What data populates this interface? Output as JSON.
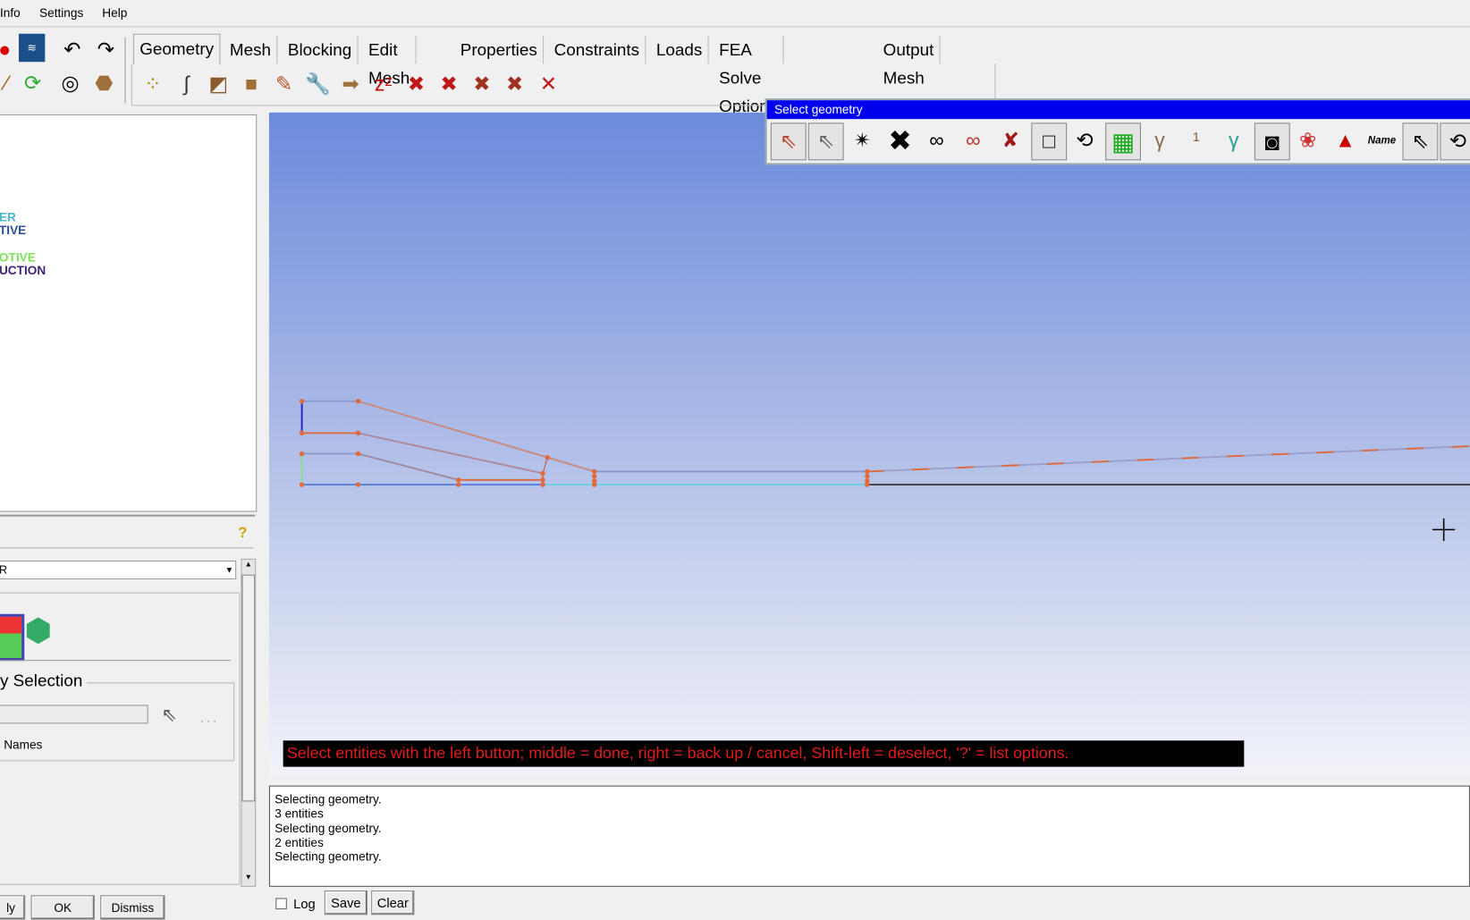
{
  "menu": {
    "items": [
      "Info",
      "Settings",
      "Help"
    ]
  },
  "tabs": [
    "Geometry",
    "Mesh",
    "Blocking",
    "Edit Mesh",
    "Properties",
    "Constraints",
    "Loads",
    "FEA Solve Options",
    "Output Mesh"
  ],
  "active_tab": "Geometry",
  "geometry_toolbar_icons": [
    "create-point-icon",
    "create-curve-icon",
    "create-surface-icon",
    "create-body-icon",
    "create-faceted-icon",
    "repair-geometry-icon",
    "transform-geometry-icon",
    "restore-dormant-icon",
    "delete-point-icon",
    "delete-curve-icon",
    "delete-surface-icon",
    "delete-body-icon",
    "delete-any-entity-icon"
  ],
  "tree": {
    "items": [
      {
        "text": "ER",
        "color": "#49b8c8"
      },
      {
        "text": "TIVE",
        "color": "#2c4fa0"
      },
      {
        "text": "OTIVE",
        "color": "#7ee05a"
      },
      {
        "text": "UCTION",
        "color": "#44227a"
      }
    ]
  },
  "left_panel": {
    "dropdown_value": "R",
    "section_title": "y Selection",
    "names_label": "Names",
    "buttons": {
      "apply": "ly",
      "ok": "OK",
      "dismiss": "Dismiss"
    }
  },
  "select_geometry": {
    "title": "Select geometry",
    "name_label": "Name",
    "icons": [
      "select-by-name-icon",
      "select-name-icon",
      "select-all-visible-icon",
      "toggle-all-icon",
      "select-visible-icon",
      "select-hidden-icon",
      "cancel-selection-icon",
      "box-select-icon",
      "polygon-select-icon",
      "select-surfaces-icon",
      "select-curves-gamma-icon",
      "select-curves-1-icon",
      "select-angle-icon",
      "select-blank-icon",
      "select-parts-icon",
      "select-shapes-icon",
      "name-icon",
      "select-points-icon",
      "select-more-icon"
    ]
  },
  "message": "Select entities with the left button; middle = done, right = back up / cancel, Shift-left = deselect, '?' = list options.",
  "log": {
    "lines": [
      "Selecting geometry.",
      "3 entities",
      "Selecting geometry.",
      "2 entities",
      "Selecting geometry."
    ],
    "log_label": "Log",
    "save": "Save",
    "clear": "Clear",
    "log_checked": false
  },
  "colors": {
    "selectbar": "#0000f0",
    "message_text": "#e21b1b",
    "geometry_orange": "#e06a3c"
  }
}
